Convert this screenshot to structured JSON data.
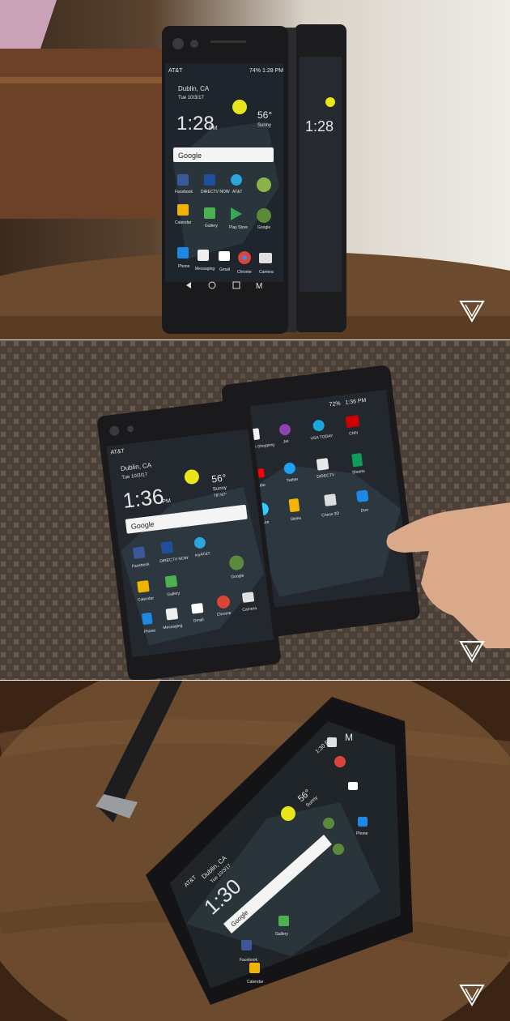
{
  "photos": [
    {
      "left_screen": {
        "carrier": "AT&T",
        "status_battery": "74%",
        "status_time": "1:28 PM",
        "location": "Dublin, CA",
        "date": "Tue 10/3/17",
        "clock": "1:28",
        "clock_ampm": "PM",
        "temp": "56°",
        "weather": "Sunny",
        "search_label": "Google",
        "apps": [
          "Facebook",
          "DIRECTV NOW",
          "AT&T",
          "Calendar",
          "Gallery",
          "Play Store",
          "Google",
          "Phone",
          "Messaging",
          "Gmail",
          "Chrome",
          "Camera"
        ]
      },
      "right_screen": {
        "clock": "1:28"
      }
    },
    {
      "left_screen": {
        "carrier": "AT&T",
        "location": "Dublin, CA",
        "date": "Tue 10/3/17",
        "clock": "1:36",
        "clock_ampm": "PM",
        "temp": "56°",
        "weather": "Sunny",
        "hilo": "78°/47°",
        "search_label": "Google",
        "apps": [
          "Facebook",
          "DIRECTV NOW",
          "myAT&T",
          "Calendar",
          "Gallery",
          "Google",
          "Phone",
          "Messaging",
          "Gmail",
          "Chrome",
          "Camera"
        ]
      },
      "right_screen": {
        "status_battery": "72%",
        "status_time": "1:36 PM",
        "apps": [
          "Amazon Shopping",
          "Jet",
          "USA TODAY",
          "CNN",
          "YouTube",
          "Twitter",
          "DIRECTV",
          "Sheets",
          "Waze",
          "Slides",
          "Chess 3D",
          "Duo"
        ]
      }
    },
    {
      "screen": {
        "carrier": "AT&T",
        "location": "Dublin, CA",
        "date": "Tue 10/3/17",
        "clock": "1:30",
        "temp": "56°",
        "weather": "Sunny",
        "status_time": "1:30 PM",
        "search_label": "Google",
        "apps": [
          "Facebook",
          "Calendar",
          "Gallery",
          "Phone"
        ]
      }
    }
  ],
  "colors": {
    "sun": "#e8e51a",
    "watermark": "#ffffff",
    "table_wood": "#6b4a2d"
  }
}
